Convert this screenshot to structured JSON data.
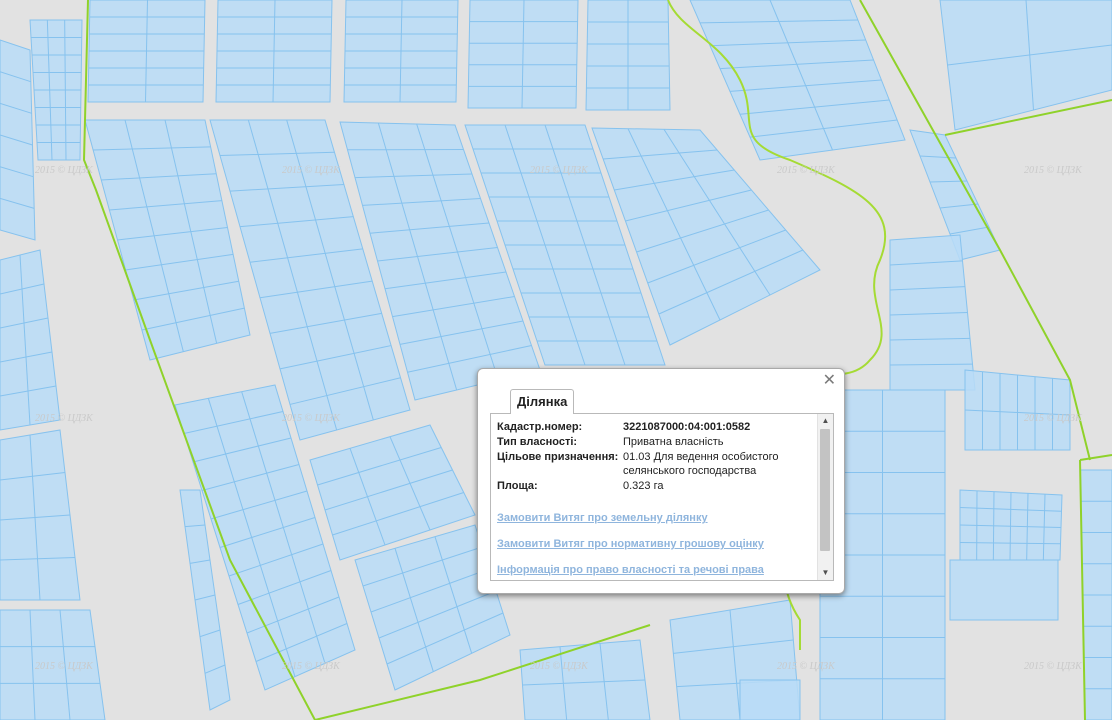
{
  "map": {
    "watermark": "2015 © ЦДЗК",
    "colors": {
      "background": "#e2e2e2",
      "parcel_fill": "#b9dcf7",
      "parcel_stroke": "#86c2ee",
      "boundary": "#8fd22a"
    }
  },
  "popup": {
    "tab_label": "Ділянка",
    "close_glyph": "✕",
    "fields": [
      {
        "label": "Кадастр.номер:",
        "value": "3221087000:04:001:0582"
      },
      {
        "label": "Тип власності:",
        "value": "Приватна власність"
      },
      {
        "label": "Цільове призначення:",
        "value": "01.03 Для ведення особистого селянського господарства"
      },
      {
        "label": "Площа:",
        "value": "0.323 га"
      }
    ],
    "links": [
      "Замовити Витяг про земельну ділянку",
      "Замовити Витяг про нормативну грошову оцінку",
      "Інформація про право власності та речові права"
    ]
  }
}
